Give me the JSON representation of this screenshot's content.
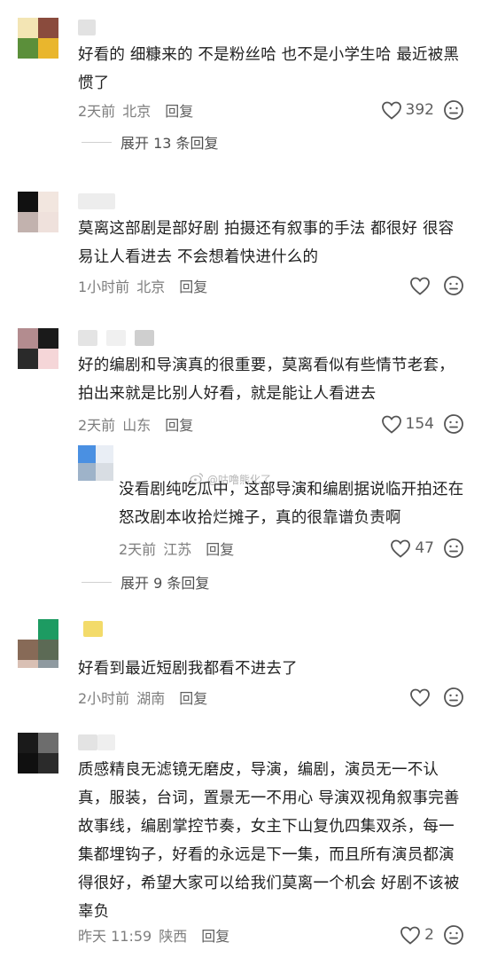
{
  "comments": [
    {
      "text": "好看的 细糠来的  不是粉丝哈  也不是小学生哈  最近被黑惯了",
      "time": "2天前",
      "location": "北京",
      "reply_label": "回复",
      "likes": "392",
      "expand": "展开 13 条回复"
    },
    {
      "text": "莫离这部剧是部好剧 拍摄还有叙事的手法 都很好 很容易让人看进去 不会想着快进什么的",
      "time": "1小时前",
      "location": "北京",
      "reply_label": "回复",
      "likes": ""
    },
    {
      "text": "好的编剧和导演真的很重要，莫离看似有些情节老套，拍出来就是比别人好看，就是能让人看进去",
      "time": "2天前",
      "location": "山东",
      "reply_label": "回复",
      "likes": "154",
      "reply": {
        "text": "没看剧纯吃瓜中，这部导演和编剧据说临开拍还在怒改剧本收拾烂摊子，真的很靠谱负责啊",
        "time": "2天前",
        "location": "江苏",
        "reply_label": "回复",
        "likes": "47"
      },
      "expand": "展开 9 条回复"
    },
    {
      "text": "好看到最近短剧我都看不进去了",
      "time": "2小时前",
      "location": "湖南",
      "reply_label": "回复",
      "likes": ""
    },
    {
      "text": "质感精良无滤镜无磨皮，导演，编剧，演员无一不认真，服装，台词，置景无一不用心        导演双视角叙事完善故事线，编剧掌控节奏，女主下山复仇四集双杀，每一集都埋钩子，好看的永远是下一集，而且所有演员都演得很好，希望大家可以给我们莫离一个机会      好剧不该被辜负",
      "time": "昨天 11:59",
      "location": "陕西",
      "reply_label": "回复",
      "likes": "2"
    }
  ],
  "watermark": "@咕噜熊化了",
  "icons": {
    "like": "heart-outline-icon",
    "dislike": "neutral-face-icon"
  }
}
